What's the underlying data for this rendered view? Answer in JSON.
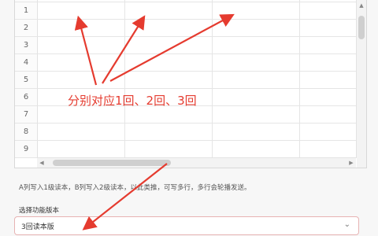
{
  "grid": {
    "row_numbers": [
      "1",
      "2",
      "3",
      "4",
      "5",
      "6",
      "7",
      "8",
      "9"
    ]
  },
  "hint_text": "A列写入1级读本，B列写入2级读本，以此类推，可写多行，多行会轮播发送。",
  "select": {
    "label": "选择功能版本",
    "value": "3回读本版"
  },
  "annotation": {
    "text": "分别对应1回、2回、3回",
    "color": "#e53b2f"
  },
  "icons": {
    "caret": "chevron-down-icon"
  }
}
